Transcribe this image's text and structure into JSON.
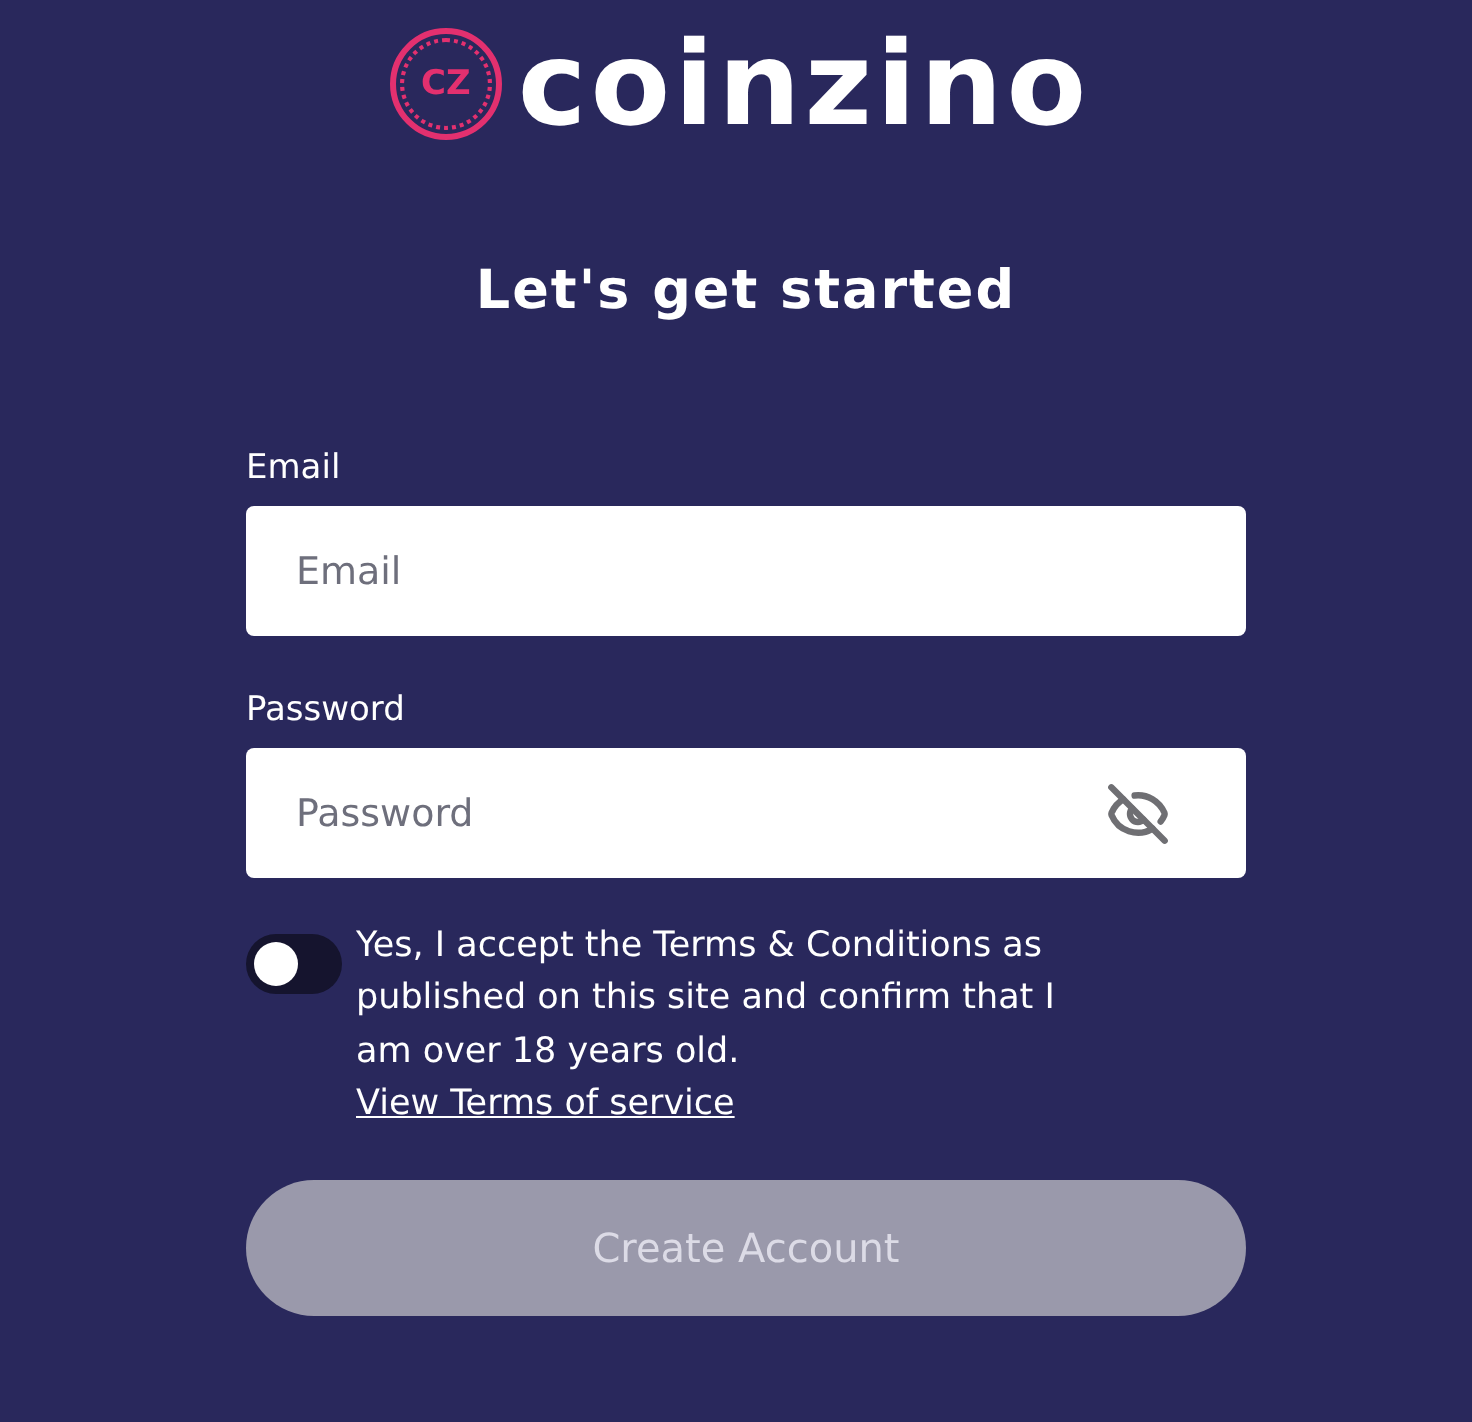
{
  "logo": {
    "badge": "CZ",
    "wordmark": "coinzino"
  },
  "heading": "Let's get started",
  "fields": [
    {
      "kind": "text",
      "label": "Email",
      "placeholder": "Email"
    },
    {
      "kind": "password",
      "label": "Password",
      "placeholder": "Password",
      "reveal": false
    }
  ],
  "consent": {
    "on": false,
    "text": "Yes, I accept the Terms & Conditions as published on this site and confirm that I am over 18 years old.",
    "link": "View Terms of service"
  },
  "submit": {
    "label": "Create Account",
    "disabled": true
  }
}
